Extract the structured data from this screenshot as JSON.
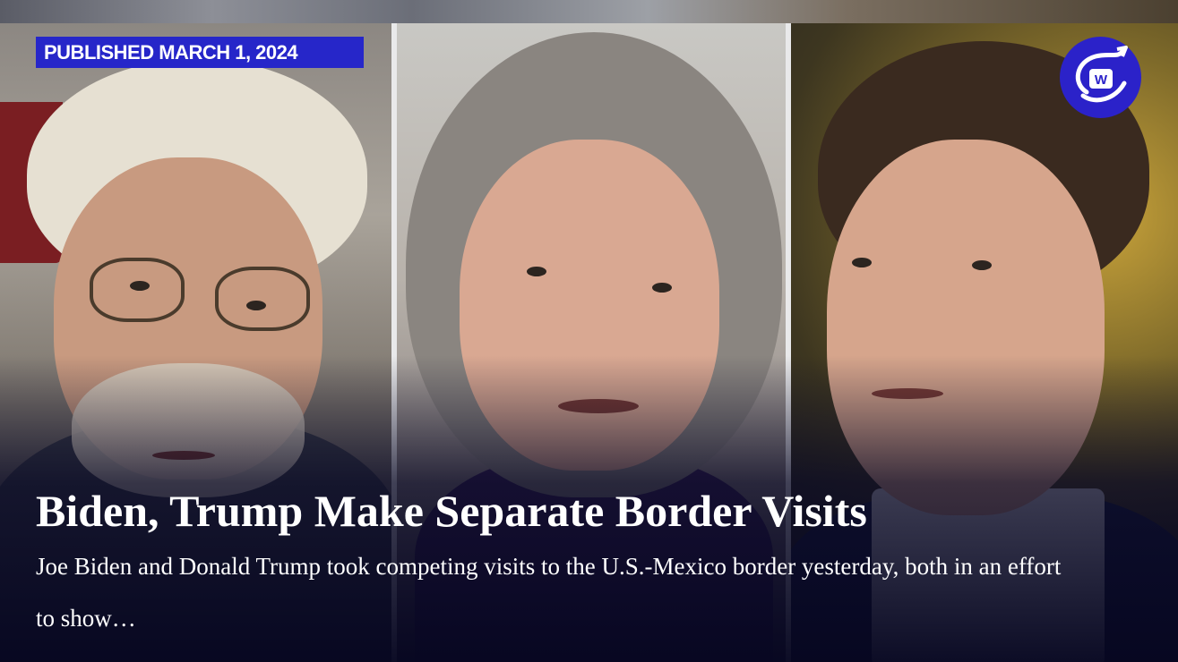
{
  "article": {
    "published_label": "PUBLISHED MARCH 1, 2024",
    "headline": "Biden, Trump Make Separate Border Visits",
    "summary": "Joe Biden and Donald Trump took competing visits to the U.S.-Mexico border yesterday, both in an effort to show…"
  },
  "logo": {
    "icon": "w-swoosh-logo-icon",
    "letter": "W"
  },
  "colors": {
    "badge_background": "#2626c9",
    "logo_background": "#2b22c9",
    "overlay": "#0b0a25",
    "text": "#ffffff"
  }
}
